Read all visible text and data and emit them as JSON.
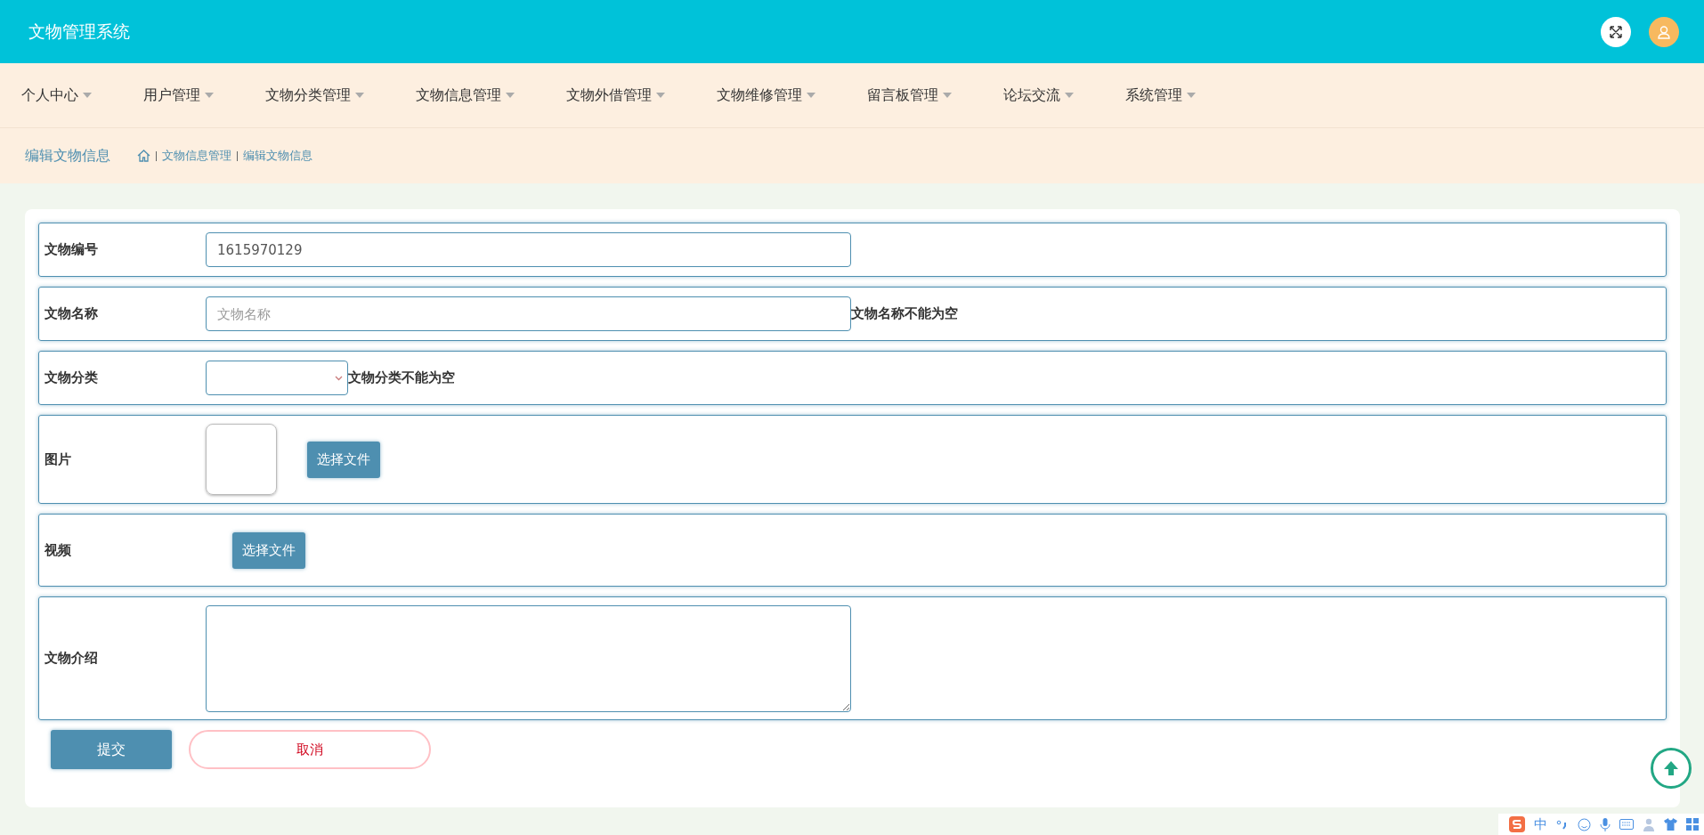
{
  "header": {
    "title": "文物管理系统"
  },
  "nav": [
    {
      "label": "个人中心"
    },
    {
      "label": "用户管理"
    },
    {
      "label": "文物分类管理"
    },
    {
      "label": "文物信息管理"
    },
    {
      "label": "文物外借管理"
    },
    {
      "label": "文物维修管理"
    },
    {
      "label": "留言板管理"
    },
    {
      "label": "论坛交流"
    },
    {
      "label": "系统管理"
    }
  ],
  "breadcrumb": {
    "title": "编辑文物信息",
    "items": [
      "文物信息管理",
      "编辑文物信息"
    ]
  },
  "form": {
    "rows": [
      {
        "kind": "input",
        "label": "文物编号",
        "value": "1615970129"
      },
      {
        "kind": "input",
        "label": "文物名称",
        "placeholder": "文物名称",
        "error": "文物名称不能为空"
      },
      {
        "kind": "select",
        "label": "文物分类",
        "error": "文物分类不能为空"
      },
      {
        "kind": "image",
        "label": "图片",
        "button": "选择文件"
      },
      {
        "kind": "video",
        "label": "视频",
        "button": "选择文件"
      },
      {
        "kind": "textarea",
        "label": "文物介绍"
      }
    ],
    "submit": "提交",
    "cancel": "取消"
  },
  "ime": {
    "mode": "中"
  }
}
